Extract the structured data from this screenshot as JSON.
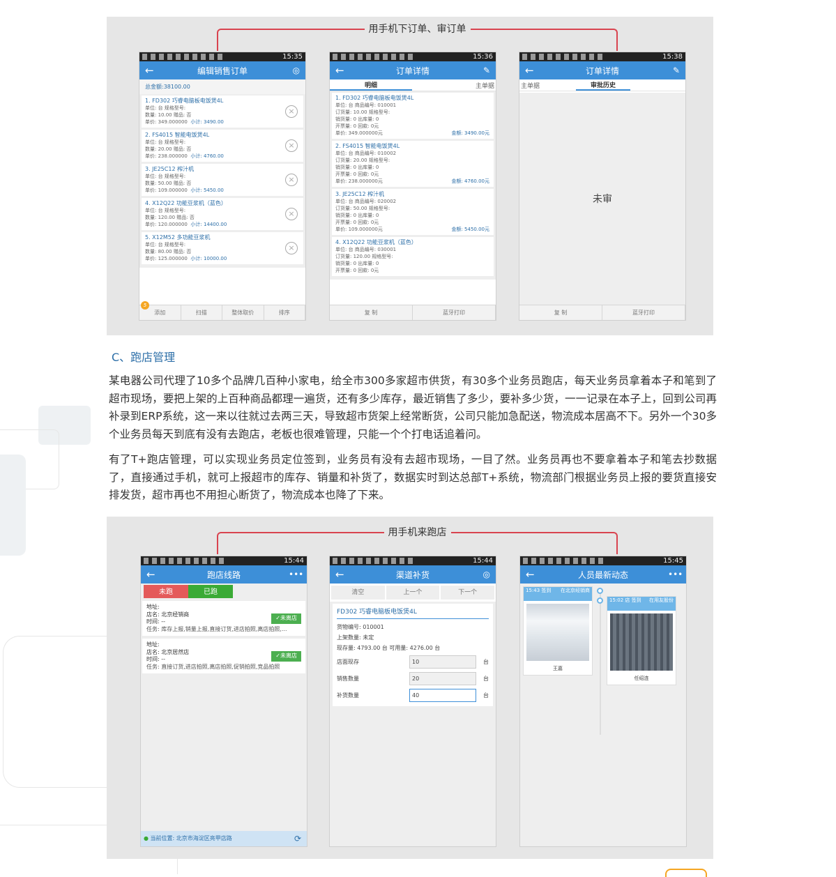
{
  "top_panel": {
    "caption": "用手机下订单、审订单",
    "phones": [
      {
        "status_time": "15:35",
        "title": "编辑销售订单",
        "back_icon": "←",
        "action_icon": "◎",
        "total": "总金额:38100.00",
        "items": [
          {
            "name": "1. FD302 巧睿电脑板电饭煲4L",
            "l1": "单位: 台  规格型号:",
            "l2": "数量: 10.00  赠品: 否",
            "l3a": "单价: 349.000000",
            "l3b": "小计: 3490.00"
          },
          {
            "name": "2. FS4015 智能电饭煲4L",
            "l1": "单位: 台  规格型号:",
            "l2": "数量: 20.00  赠品: 否",
            "l3a": "单价: 238.000000",
            "l3b": "小计: 4760.00"
          },
          {
            "name": "3. JE25C12 榨汁机",
            "l1": "单位: 台  规格型号:",
            "l2": "数量: 50.00  赠品: 否",
            "l3a": "单价: 109.000000",
            "l3b": "小计: 5450.00"
          },
          {
            "name": "4. X12Q22 功能豆浆机（蓝色）",
            "l1": "单位: 台  规格型号:",
            "l2": "数量: 120.00  赠品: 否",
            "l3a": "单价: 120.000000",
            "l3b": "小计: 14400.00"
          },
          {
            "name": "5. X12M52 多功能豆浆机",
            "l1": "单位: 台  规格型号:",
            "l2": "数量: 80.00  赠品: 否",
            "l3a": "单价: 125.000000",
            "l3b": "小计: 10000.00"
          }
        ],
        "buttons": [
          "添加",
          "扫描",
          "整体取价",
          "排序"
        ],
        "badge": "5"
      },
      {
        "status_time": "15:36",
        "title": "订单详情",
        "back_icon": "←",
        "action_icon": "✎",
        "tabs": [
          "明细",
          "主单据"
        ],
        "items": [
          {
            "name": "1. FD302 巧睿电脑板电饭煲4L",
            "l1": "单位: 台  商品编号: 010001",
            "l2": "订货量: 10.00  规格型号:",
            "l3": "销货量: 0  出库量: 0",
            "l4": "开票量: 0  回款: 0元",
            "l5": "单价: 349.000000元",
            "amt": "金额: 3490.00元"
          },
          {
            "name": "2. FS4015 智能电饭煲4L",
            "l1": "单位: 台  商品编号: 010002",
            "l2": "订货量: 20.00  规格型号:",
            "l3": "销货量: 0  出库量: 0",
            "l4": "开票量: 0  回款: 0元",
            "l5": "单价: 238.000000元",
            "amt": "金额: 4760.00元"
          },
          {
            "name": "3. JE25C12 榨汁机",
            "l1": "单位: 台  商品编号: 020002",
            "l2": "订货量: 50.00  规格型号:",
            "l3": "销货量: 0  出库量: 0",
            "l4": "开票量: 0  回款: 0元",
            "l5": "单价: 109.000000元",
            "amt": "金额: 5450.00元"
          },
          {
            "name": "4. X12Q22 功能豆浆机（蓝色）",
            "l1": "单位: 台  商品编号: 030001",
            "l2": "订货量: 120.00  规格型号:",
            "l3": "销货量: 0  出库量: 0",
            "l4": "开票量: 0  回款: 0元",
            "l5": "",
            "amt": ""
          }
        ],
        "buttons": [
          "复  制",
          "蓝牙打印"
        ]
      },
      {
        "status_time": "15:38",
        "title": "订单详情",
        "back_icon": "←",
        "action_icon": "✎",
        "tabs": [
          "主单据",
          "审批历史"
        ],
        "center_text": "未审",
        "buttons": [
          "复  制",
          "蓝牙打印"
        ]
      }
    ]
  },
  "section": {
    "heading": "C、跑店管理",
    "para1": "某电器公司代理了10多个品牌几百种小家电，给全市300多家超市供货，有30多个业务员跑店，每天业务员拿着本子和笔到了超市现场，要把上架的上百种商品都理一遍货，还有多少库存，最近销售了多少，要补多少货，一一记录在本子上，回到公司再补录到ERP系统，这一来以往就过去两三天，导致超市货架上经常断货，公司只能加急配送，物流成本居高不下。另外一个30多个业务员每天到底有没有去跑店，老板也很难管理，只能一个个打电话追着问。",
    "para2": "有了T+跑店管理，可以实现业务员定位签到，业务员有没有去超市现场，一目了然。业务员再也不要拿着本子和笔去抄数据了，直接通过手机，就可上报超市的库存、销量和补货了，数据实时到达总部T+系统，物流部门根据业务员上报的要货直接安排发货，超市再也不用担心断货了，物流成本也降了下来。"
  },
  "bottom_panel": {
    "caption": "用手机来跑店",
    "phones": [
      {
        "status_time": "15:44",
        "title": "跑店线路",
        "back_icon": "←",
        "action_icon": "•••",
        "segs": [
          "未跑",
          "已跑"
        ],
        "seg_colors": [
          "#e45a5a",
          "#3aaa35"
        ],
        "stores": [
          {
            "addr": "地址:",
            "name": "店名: 北京经销商",
            "time": "时间: --",
            "tasks": "任务: 库存上报,销量上报,直接订货,进店拍照,离店拍照,...",
            "btn": "✓未离店"
          },
          {
            "addr": "地址:",
            "name": "店名: 北京居然店",
            "time": "时间: --",
            "tasks": "任务: 直接订货,进店拍照,离店拍照,促销拍照,竞品拍照",
            "btn": "✓未离店"
          }
        ],
        "location": "当前位置: 北京市海淀区亮甲店路",
        "refresh_icon": "⟳"
      },
      {
        "status_time": "15:44",
        "title": "渠道补货",
        "back_icon": "←",
        "action_icon": "◎",
        "actions": [
          "清空",
          "上一个",
          "下一个"
        ],
        "product": "FD302 巧睿电脑板电饭煲4L",
        "info": [
          "货物编号: 010001",
          "上架数量: 未定",
          "现存量: 4793.00 台  可用量: 4276.00 台"
        ],
        "fields": [
          {
            "label": "店面现存",
            "value": "10",
            "unit": "台"
          },
          {
            "label": "销售数量",
            "value": "20",
            "unit": "台"
          },
          {
            "label": "补货数量",
            "value": "40",
            "unit": "台"
          }
        ]
      },
      {
        "status_time": "15:45",
        "title": "人员最新动态",
        "back_icon": "←",
        "action_icon": "•••",
        "posts": [
          {
            "time": "15:43 签到",
            "loc": "在北京经销商",
            "person": "王嘉"
          },
          {
            "time": "15:02 店 签到",
            "loc": "在用友股份",
            "person": "任绍连"
          }
        ]
      }
    ]
  }
}
